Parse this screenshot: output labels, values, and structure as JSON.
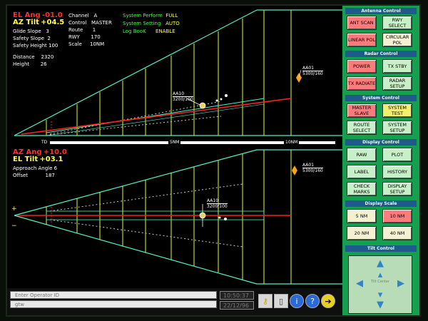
{
  "top_scope": {
    "el_ang_label": "EL Ang",
    "el_ang_value": "-01.0",
    "az_tilt_label": "AZ Tilt",
    "az_tilt_value": "+04.5",
    "glide_slope_label": "Glide Slope",
    "glide_slope_value": "3",
    "safety_slope_label": "Safety Slope",
    "safety_slope_value": "2",
    "safety_height_label": "Safety Height",
    "safety_height_value": "100",
    "distance_label": "Distance",
    "distance_value": "2320",
    "height_label": "Height",
    "height_value": "26",
    "channel_label": "Channel",
    "channel_value": "A",
    "control_label": "Control",
    "control_value": "MASTER",
    "route_label": "Route",
    "route_value": "1",
    "rwy_label": "RWY",
    "rwy_value": "170",
    "scale_label": "Scale",
    "scale_value": "10NM",
    "sys_perform_label": "System Perform",
    "sys_perform_value": "FULL",
    "sys_setting_label": "System Setting",
    "sys_setting_value": "AUTO",
    "logbook_label": "Log BooK",
    "logbook_value": "ENABLE",
    "track1_name": "AA10",
    "track1_data": "3200/100",
    "track2_name": "AA01",
    "track2_data": "5300/160"
  },
  "range_bar": {
    "td": "TD",
    "mid": "5NM",
    "end": "10NM"
  },
  "bottom_scope": {
    "az_ang_label": "AZ Ang",
    "az_ang_value": "+10.0",
    "el_tilt_label": "EL Tilt",
    "el_tilt_value": "+03.1",
    "approach_angle_label": "Approach Angle",
    "approach_angle_value": "6",
    "offset_label": "Offset",
    "offset_value": "187",
    "plus_marker": "+",
    "minus_marker": "−",
    "track1_name": "AA10",
    "track1_data": "3200/100",
    "track2_name": "AA01",
    "track2_data": "5300/160"
  },
  "panel": {
    "antenna_control": "Antenna Control",
    "ant_scan": "ANT SCAN",
    "rwy_select": "RWY SELECT",
    "linear_pol": "LINEAR POL",
    "circular_pol": "CIRCULAR POL",
    "radar_control": "Radar Control",
    "power": "POWER",
    "tx_stby": "TX STBY",
    "tx_radiate": "TX RADIATE",
    "radar_setup": "RADAR SETUP",
    "system_control": "System Control",
    "master_slave": "MASTER SLAVE",
    "system_test": "SYSTEM TEST",
    "route_select": "ROUTE SELECT",
    "system_setup": "SYSTEM SETUP",
    "display_control": "Display Control",
    "raw": "RAW",
    "plot": "PLOT",
    "label": "LABEL",
    "history": "HISTORY",
    "check_marks": "CHECK MARKS",
    "display_setup": "DISPLAY SETUP",
    "display_scale": "Display Scale",
    "nm5": "5 NM",
    "nm10": "10 NM",
    "nm20": "20 NM",
    "nm40": "40 NM",
    "tilt_control": "Tilt Control",
    "tilt_center": "Tilt Center"
  },
  "status": {
    "operator_placeholder": "Enter Operator ID",
    "second_field": "gtw",
    "time": "10:50:37",
    "date": "22/12/96"
  },
  "colors": {
    "scope_line": "#4ff0c8",
    "grid_line": "#d8ff30",
    "glide_red": "#ff2020",
    "panel_bg": "#15a050",
    "section_bg": "#1e5a8c"
  }
}
